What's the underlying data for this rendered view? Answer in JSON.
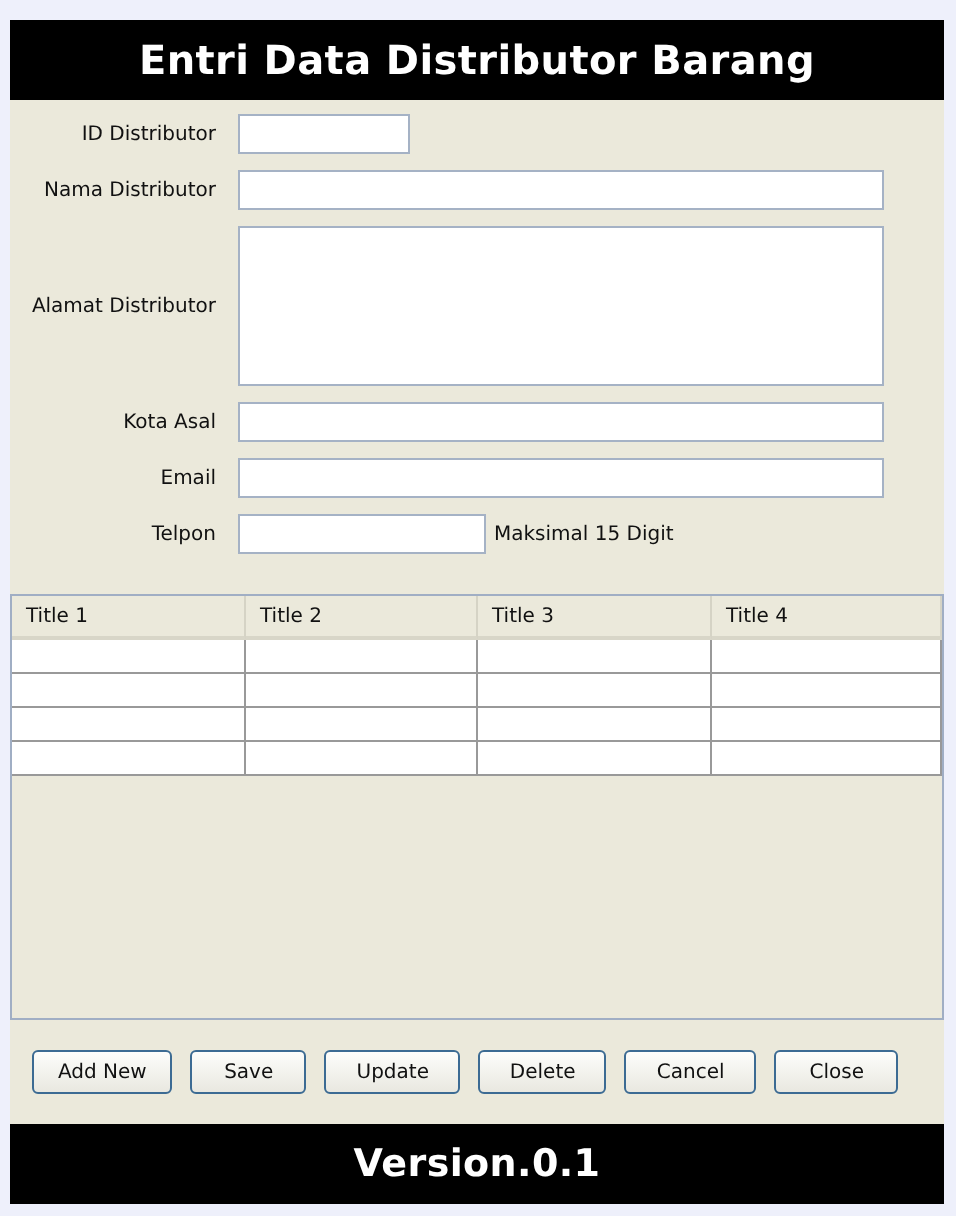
{
  "header": {
    "title": "Entri Data Distributor Barang"
  },
  "form": {
    "fields": [
      {
        "label": "ID Distributor",
        "kind": "short"
      },
      {
        "label": "Nama Distributor",
        "kind": "long"
      },
      {
        "label": "Alamat Distributor",
        "kind": "area"
      },
      {
        "label": "Kota Asal",
        "kind": "long"
      },
      {
        "label": "Email",
        "kind": "long"
      },
      {
        "label": "Telpon",
        "kind": "medium",
        "hint": "Maksimal 15 Digit"
      }
    ]
  },
  "table": {
    "columns": [
      "Title 1",
      "Title 2",
      "Title 3",
      "Title 4"
    ]
  },
  "buttons": [
    "Add New",
    "Save",
    "Update",
    "Delete",
    "Cancel",
    "Close"
  ],
  "footer": {
    "version": "Version.0.1"
  }
}
